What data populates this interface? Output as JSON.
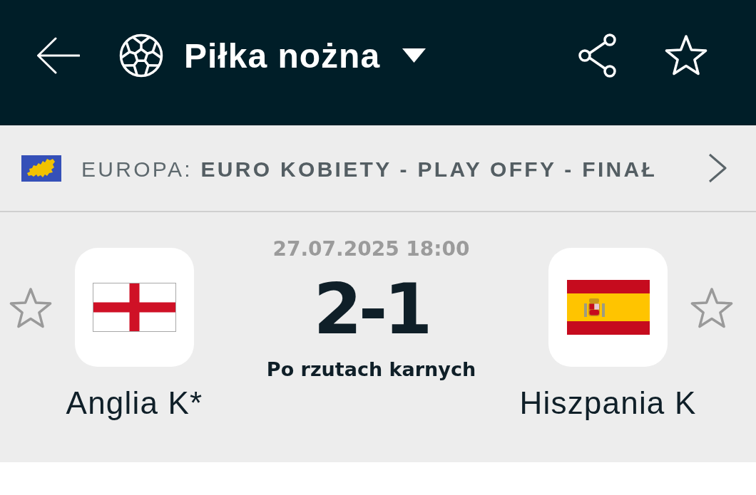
{
  "header": {
    "title": "Piłka nożna",
    "favorite": false
  },
  "breadcrumb": {
    "text": "EUROPA: **EURO KOBIETY - PLAY OFFY - FINAŁ**"
  },
  "match": {
    "datetime": "27.07.2025 18:00",
    "score": "2-1",
    "status": "Po rzutach karnych",
    "teams": [
      {
        "name": "Anglia K*",
        "kind": "england",
        "favorite": false
      },
      {
        "name": "Hiszpania K",
        "kind": "spain",
        "favorite": false
      }
    ]
  }
}
